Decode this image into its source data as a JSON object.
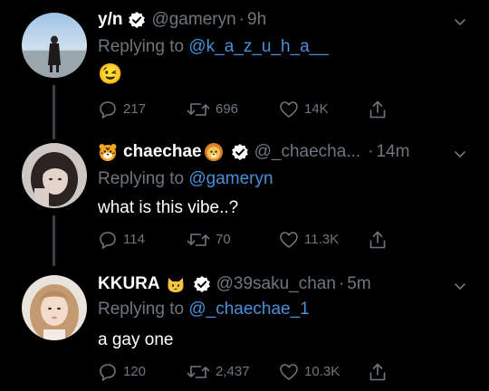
{
  "colors": {
    "background": "#000000",
    "text": "#ffffff",
    "muted": "#6e767d",
    "link": "#4a90d9",
    "thread_line": "#3d4145"
  },
  "tweets": [
    {
      "name": "y/n",
      "name_prefix_emoji": "",
      "name_suffix_emoji": "",
      "verified": true,
      "handle": "@gameryn",
      "dot": "·",
      "time": "9h",
      "replying_prefix": "Replying to",
      "replying_to": "@k_a_z_u_h_a__",
      "text": "😉",
      "replies": "217",
      "retweets": "696",
      "likes": "14K"
    },
    {
      "name": "chaechae",
      "name_prefix_emoji": "tiger-face-icon",
      "name_suffix_emoji": "lion-face-icon",
      "verified": true,
      "handle": "@_chaecha...",
      "dot": "·",
      "time": "14m",
      "replying_prefix": "Replying to",
      "replying_to": "@gameryn",
      "text": "what is this vibe..?",
      "replies": "114",
      "retweets": "70",
      "likes": "11.3K"
    },
    {
      "name": "KKURA",
      "name_prefix_emoji": "",
      "name_suffix_emoji": "cat-face-icon",
      "verified": true,
      "handle": "@39saku_chan",
      "dot": "·",
      "time": "5m",
      "replying_prefix": "Replying to",
      "replying_to": "@_chaechae_1",
      "text": "a gay one",
      "replies": "120",
      "retweets": "2,437",
      "likes": "10.3K"
    }
  ]
}
